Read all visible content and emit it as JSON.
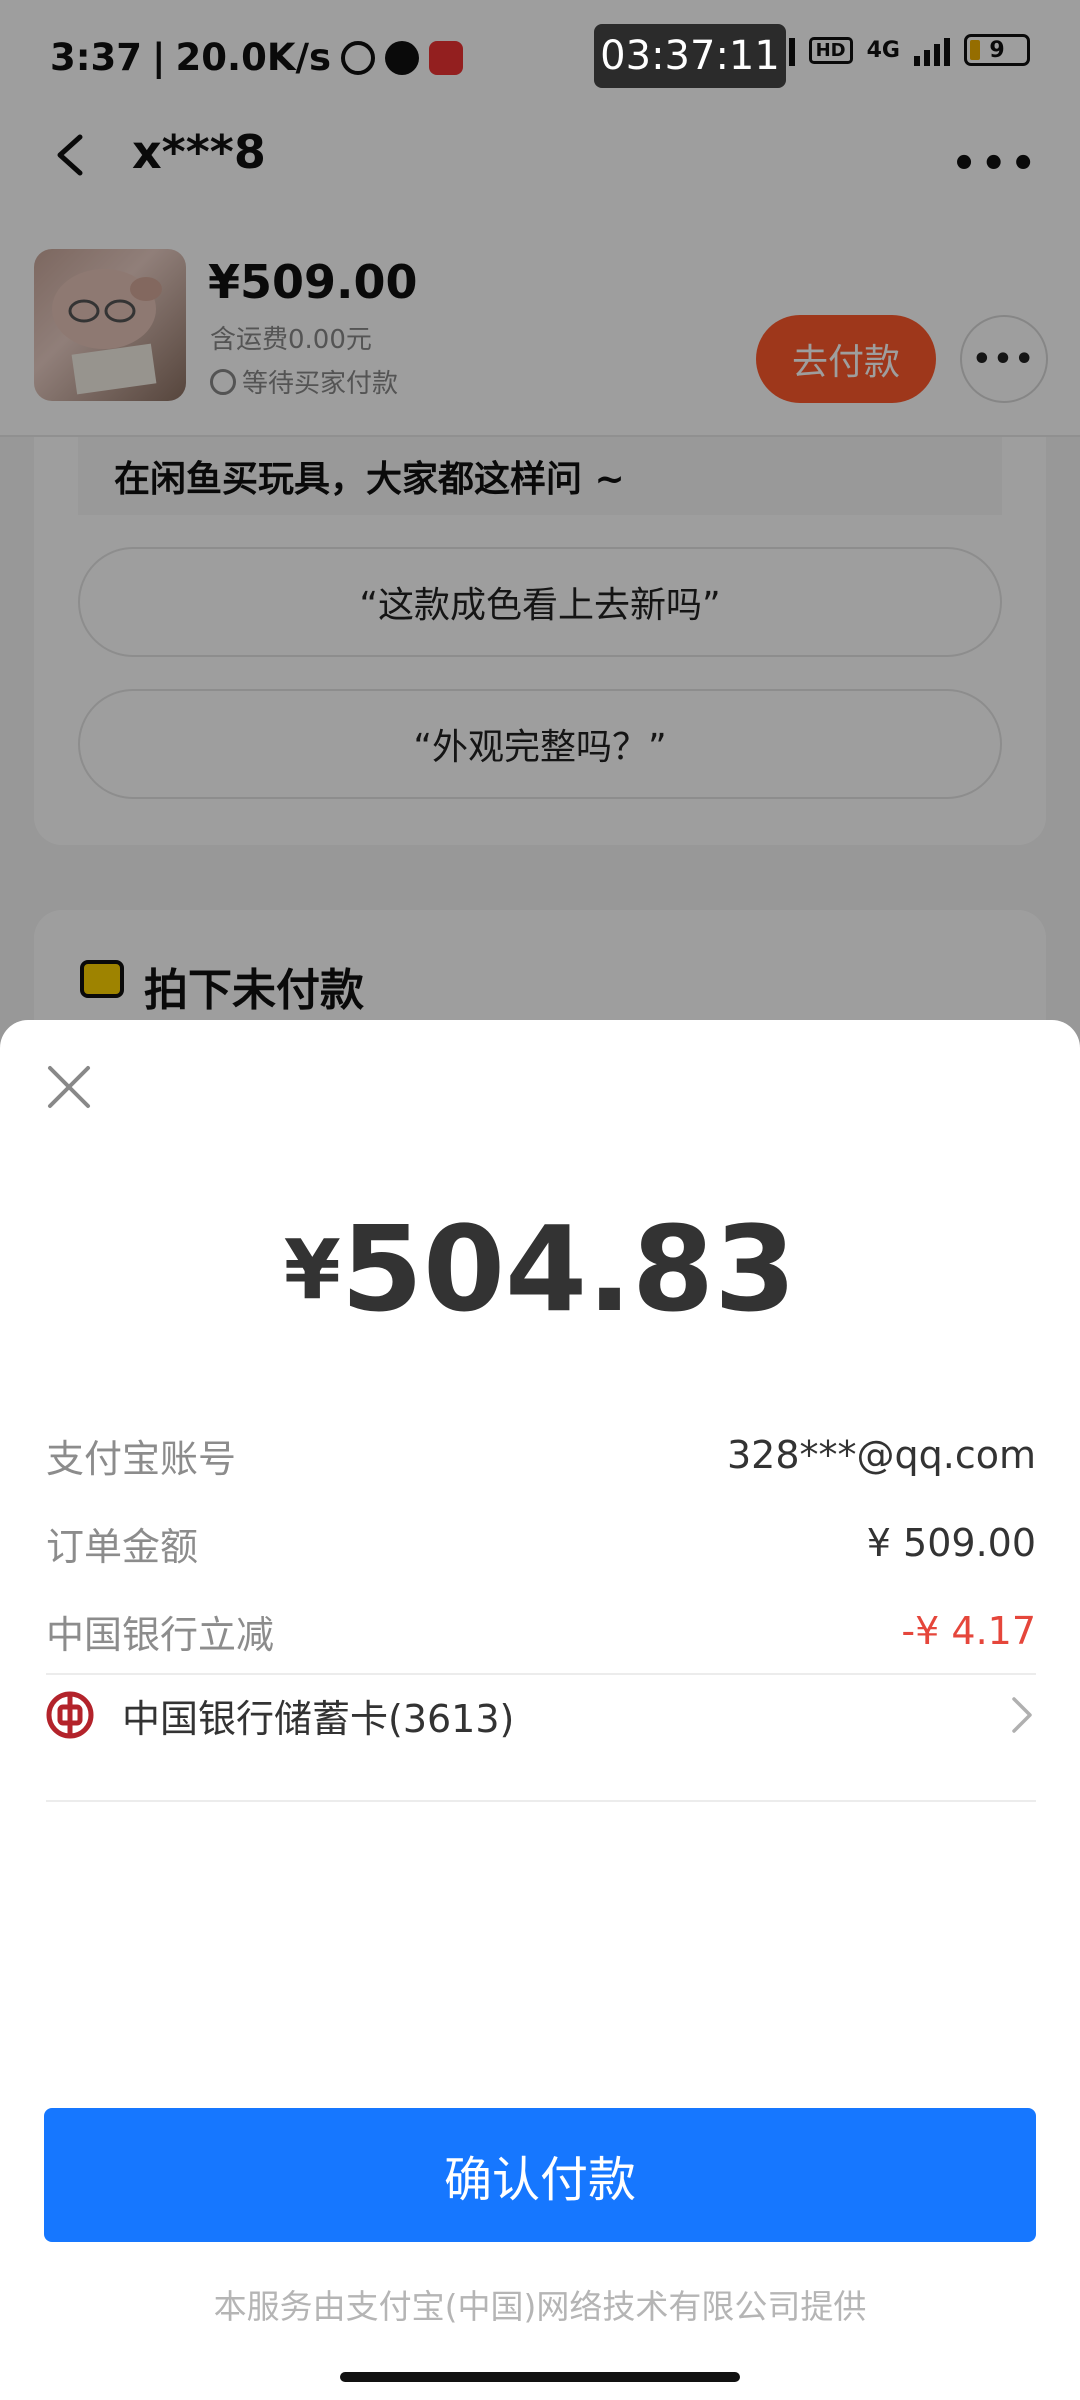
{
  "status_bar": {
    "time": "3:37",
    "network_speed": "20.0K/s",
    "overlay_clock": "03:37:11",
    "net_type_1": "4G",
    "net_type_2": "4G",
    "hd_label": "HD",
    "battery": "9"
  },
  "header": {
    "title": "x***8"
  },
  "order": {
    "price": "¥509.00",
    "shipping": "含运费0.00元",
    "status": "等待买家付款",
    "pay_button": "去付款"
  },
  "faq": {
    "heading": "在闲鱼买玩具，大家都这样问 ~",
    "questions": [
      "“这款成色看上去新吗”",
      "“外观完整吗？”"
    ]
  },
  "unpaid": {
    "title": "拍下未付款"
  },
  "payment_sheet": {
    "currency_symbol": "¥",
    "amount": "504.83",
    "rows": [
      {
        "label": "支付宝账号",
        "value": "328***@qq.com"
      },
      {
        "label": "订单金额",
        "value": "¥ 509.00"
      },
      {
        "label": "中国银行立减",
        "value": "-¥ 4.17"
      }
    ],
    "discount_color": "#e5463b",
    "payment_method": "中国银行储蓄卡(3613)",
    "confirm_button": "确认付款",
    "confirm_color": "#1677ff",
    "footer": "本服务由支付宝(中国)网络技术有限公司提供"
  }
}
